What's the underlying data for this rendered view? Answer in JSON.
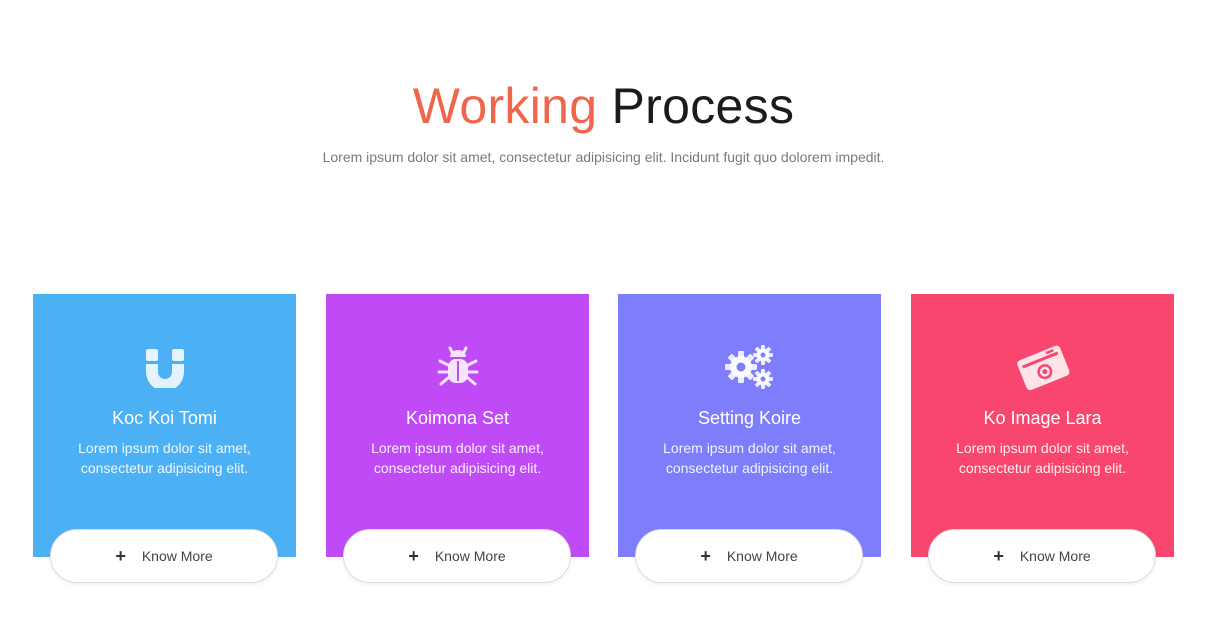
{
  "header": {
    "title_accent": "Working",
    "title_rest": "Process",
    "subtitle": "Lorem ipsum dolor sit amet, consectetur adipisicing elit. Incidunt fugit quo dolorem impedit."
  },
  "colors": {
    "accent": "#f0664c",
    "card_1": "#4bb0f4",
    "card_2": "#c14af7",
    "card_3": "#7e7dfb",
    "card_4": "#f9466e"
  },
  "cards": [
    {
      "icon": "magnet-icon",
      "title": "Koc Koi Tomi",
      "text": "Lorem ipsum dolor sit amet, consectetur adipisicing elit.",
      "button_label": "Know More"
    },
    {
      "icon": "bug-icon",
      "title": "Koimona Set",
      "text": "Lorem ipsum dolor sit amet, consectetur adipisicing elit.",
      "button_label": "Know More"
    },
    {
      "icon": "gears-icon",
      "title": "Setting Koire",
      "text": "Lorem ipsum dolor sit amet, consectetur adipisicing elit.",
      "button_label": "Know More"
    },
    {
      "icon": "camera-icon",
      "title": "Ko Image Lara",
      "text": "Lorem ipsum dolor sit amet, consectetur adipisicing elit.",
      "button_label": "Know More"
    }
  ]
}
